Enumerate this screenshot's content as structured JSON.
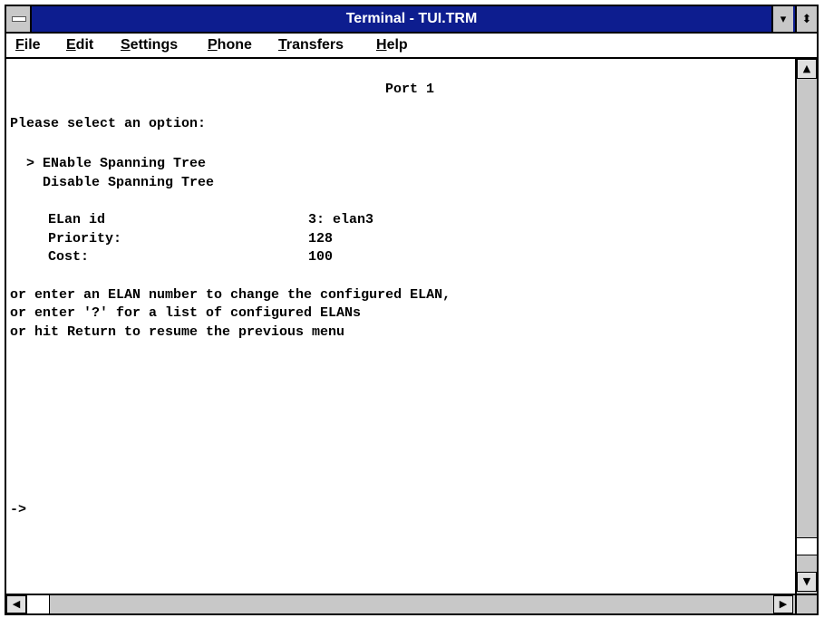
{
  "window": {
    "title": "Terminal - TUI.TRM",
    "minimize_glyph": "▾",
    "restore_glyph": "⬍"
  },
  "menu": {
    "file": "File",
    "edit": "Edit",
    "settings": "Settings",
    "phone": "Phone",
    "transfers": "Transfers",
    "help": "Help"
  },
  "terminal": {
    "header": "Port 1",
    "prompt": "Please select an option:",
    "options": {
      "enable": "  > ENable Spanning Tree",
      "disable": "    Disable Spanning Tree"
    },
    "fields": {
      "elan_label": "ELan id",
      "elan_value": "3: elan3",
      "priority_label": "Priority:",
      "priority_value": "128",
      "cost_label": "Cost:",
      "cost_value": "100"
    },
    "help_lines": [
      "or enter an ELAN number to change the configured ELAN,",
      "or enter '?' for a list of configured ELANs",
      "or hit Return to resume the previous menu"
    ],
    "cursor_prompt": "->"
  },
  "scrollbar": {
    "up_glyph": "▲",
    "down_glyph": "▼",
    "left_glyph": "◀",
    "right_glyph": "▶"
  },
  "colors": {
    "titlebar": "#0d1d8f",
    "chrome": "#c8c8c8"
  }
}
